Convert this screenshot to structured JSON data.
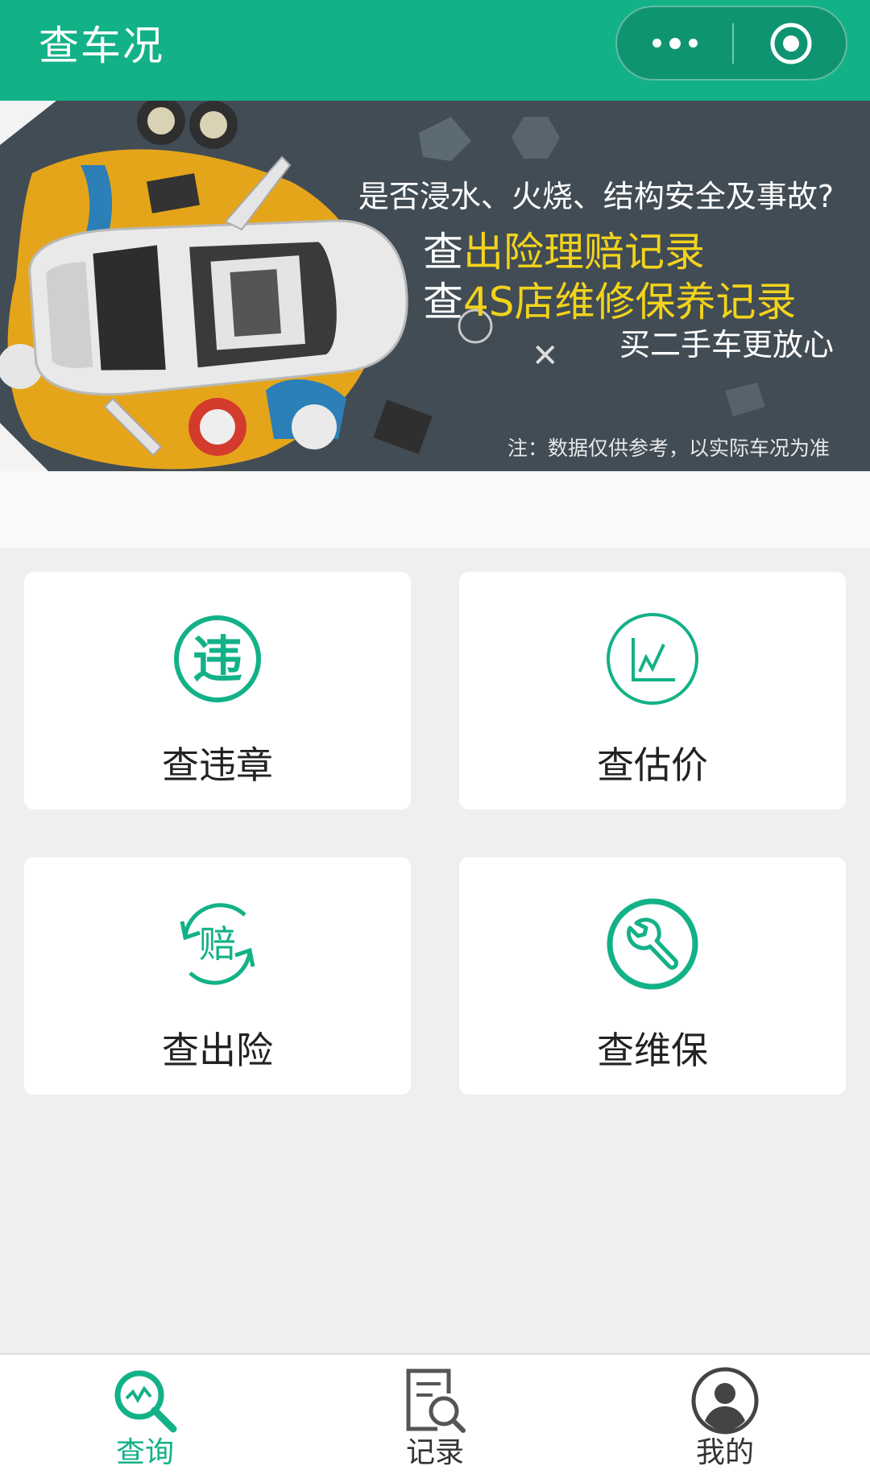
{
  "header": {
    "title": "查车况",
    "more_icon": "more-dots-icon",
    "close_icon": "target-close-icon",
    "background": "#13b187"
  },
  "banner": {
    "line1": "是否浸水、火烧、结构安全及事故?",
    "line2_prefix": "查",
    "line2_rest": "出险理赔记录",
    "line3_prefix": "查",
    "line3_rest": "4S店维修保养记录",
    "line4": "买二手车更放心",
    "note": "注：数据仅供参考，以实际车况为准",
    "highlight_color": "#f2d31b"
  },
  "cards": [
    {
      "label": "查违章",
      "icon": "violation-icon",
      "icon_text": "违"
    },
    {
      "label": "查估价",
      "icon": "chart-icon"
    },
    {
      "label": "查出险",
      "icon": "claim-icon",
      "icon_text": "赔"
    },
    {
      "label": "查维保",
      "icon": "wrench-icon"
    }
  ],
  "tabbar": {
    "items": [
      {
        "label": "查询",
        "icon": "search-icon",
        "active": true
      },
      {
        "label": "记录",
        "icon": "records-icon",
        "active": false
      },
      {
        "label": "我的",
        "icon": "profile-icon",
        "active": false
      }
    ],
    "active_color": "#13b187",
    "inactive_color": "#333333"
  },
  "accent": "#13b187"
}
